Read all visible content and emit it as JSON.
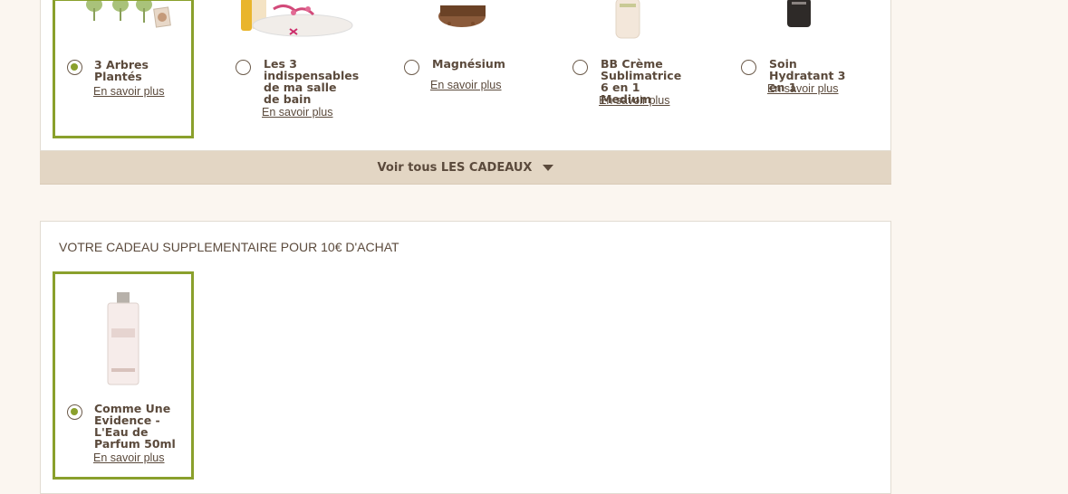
{
  "gifts_top": [
    {
      "name": "3 Arbres Plantés",
      "more": "En savoir plus",
      "selected": true
    },
    {
      "name": "Les 3 indispensables de ma salle de bain",
      "more": "En savoir plus",
      "selected": false
    },
    {
      "name": "Magnésium",
      "more": "En savoir plus",
      "selected": false
    },
    {
      "name": "BB Crème Sublimatrice 6 en 1 Medium",
      "more": "En savoir plus",
      "selected": false
    },
    {
      "name": "Soin Hydratant 3 en 1",
      "more": "En savoir plus",
      "selected": false
    }
  ],
  "voir_tous": {
    "prefix": "Voir tous ",
    "label": "LES CADEAUX"
  },
  "extra": {
    "title": "VOTRE CADEAU SUPPLEMENTAIRE POUR 10€ D'ACHAT",
    "gift": {
      "name": "Comme Une Evidence - L'Eau de Parfum 50ml",
      "more": "En savoir plus",
      "selected": true
    }
  },
  "colors": {
    "accent": "#8aa02c",
    "text": "#5b4a3c",
    "bar": "#e3d6c4",
    "page_bg": "#fbf6f0"
  }
}
